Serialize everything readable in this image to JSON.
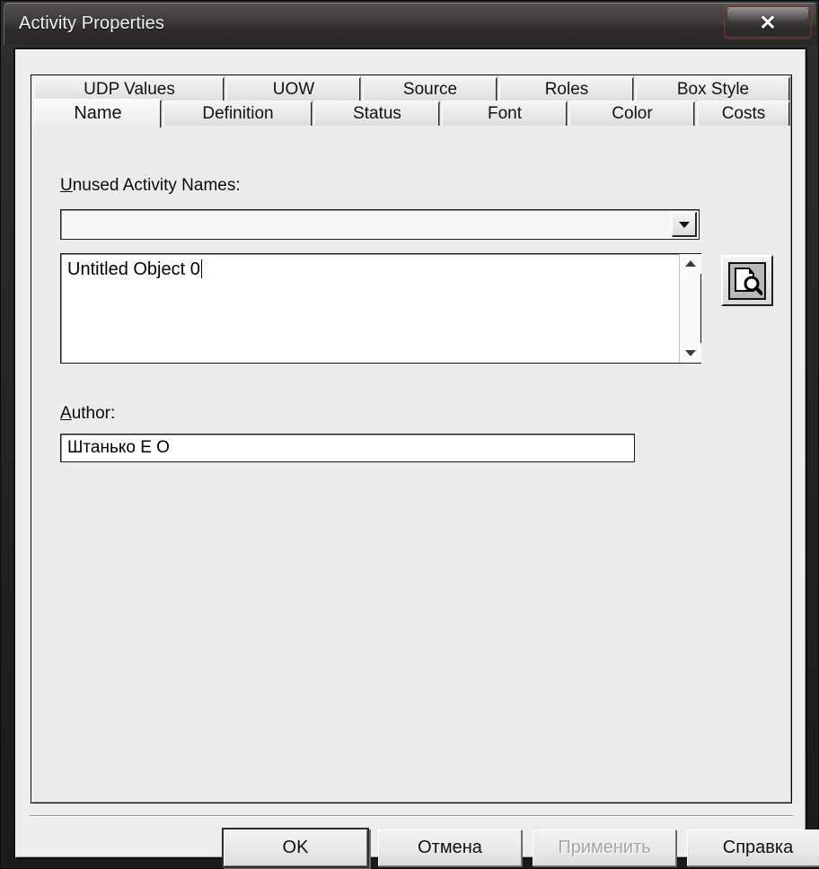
{
  "window": {
    "title": "Activity Properties",
    "close_glyph": "✕",
    "close_icon_name": "close-icon"
  },
  "tabs": {
    "top_row": [
      {
        "label": "UDP Values",
        "selected": false
      },
      {
        "label": "UOW",
        "selected": false
      },
      {
        "label": "Source",
        "selected": false
      },
      {
        "label": "Roles",
        "selected": false
      },
      {
        "label": "Box Style",
        "selected": false
      }
    ],
    "bottom_row": [
      {
        "label": "Name",
        "selected": true
      },
      {
        "label": "Definition",
        "selected": false
      },
      {
        "label": "Status",
        "selected": false
      },
      {
        "label": "Font",
        "selected": false
      },
      {
        "label": "Color",
        "selected": false
      },
      {
        "label": "Costs",
        "selected": false
      }
    ]
  },
  "page": {
    "unused_names": {
      "label_prefix": "U",
      "label_rest": "nused Activity Names:",
      "value": "",
      "placeholder": ""
    },
    "name_edit": {
      "value": "Untitled Object 0"
    },
    "tool_button": {
      "icon_name": "document-magnifier-icon"
    },
    "author": {
      "label_prefix": "A",
      "label_rest": "uthor:",
      "value": "Штанько Е О"
    }
  },
  "buttons": {
    "ok": "OK",
    "cancel": "Отмена",
    "apply": "Применить",
    "help": "Справка"
  },
  "colors": {
    "dialog_face": "#ededed",
    "panel_face": "#ececec",
    "close_red": "#b2281a",
    "field_white": "#ffffff"
  }
}
